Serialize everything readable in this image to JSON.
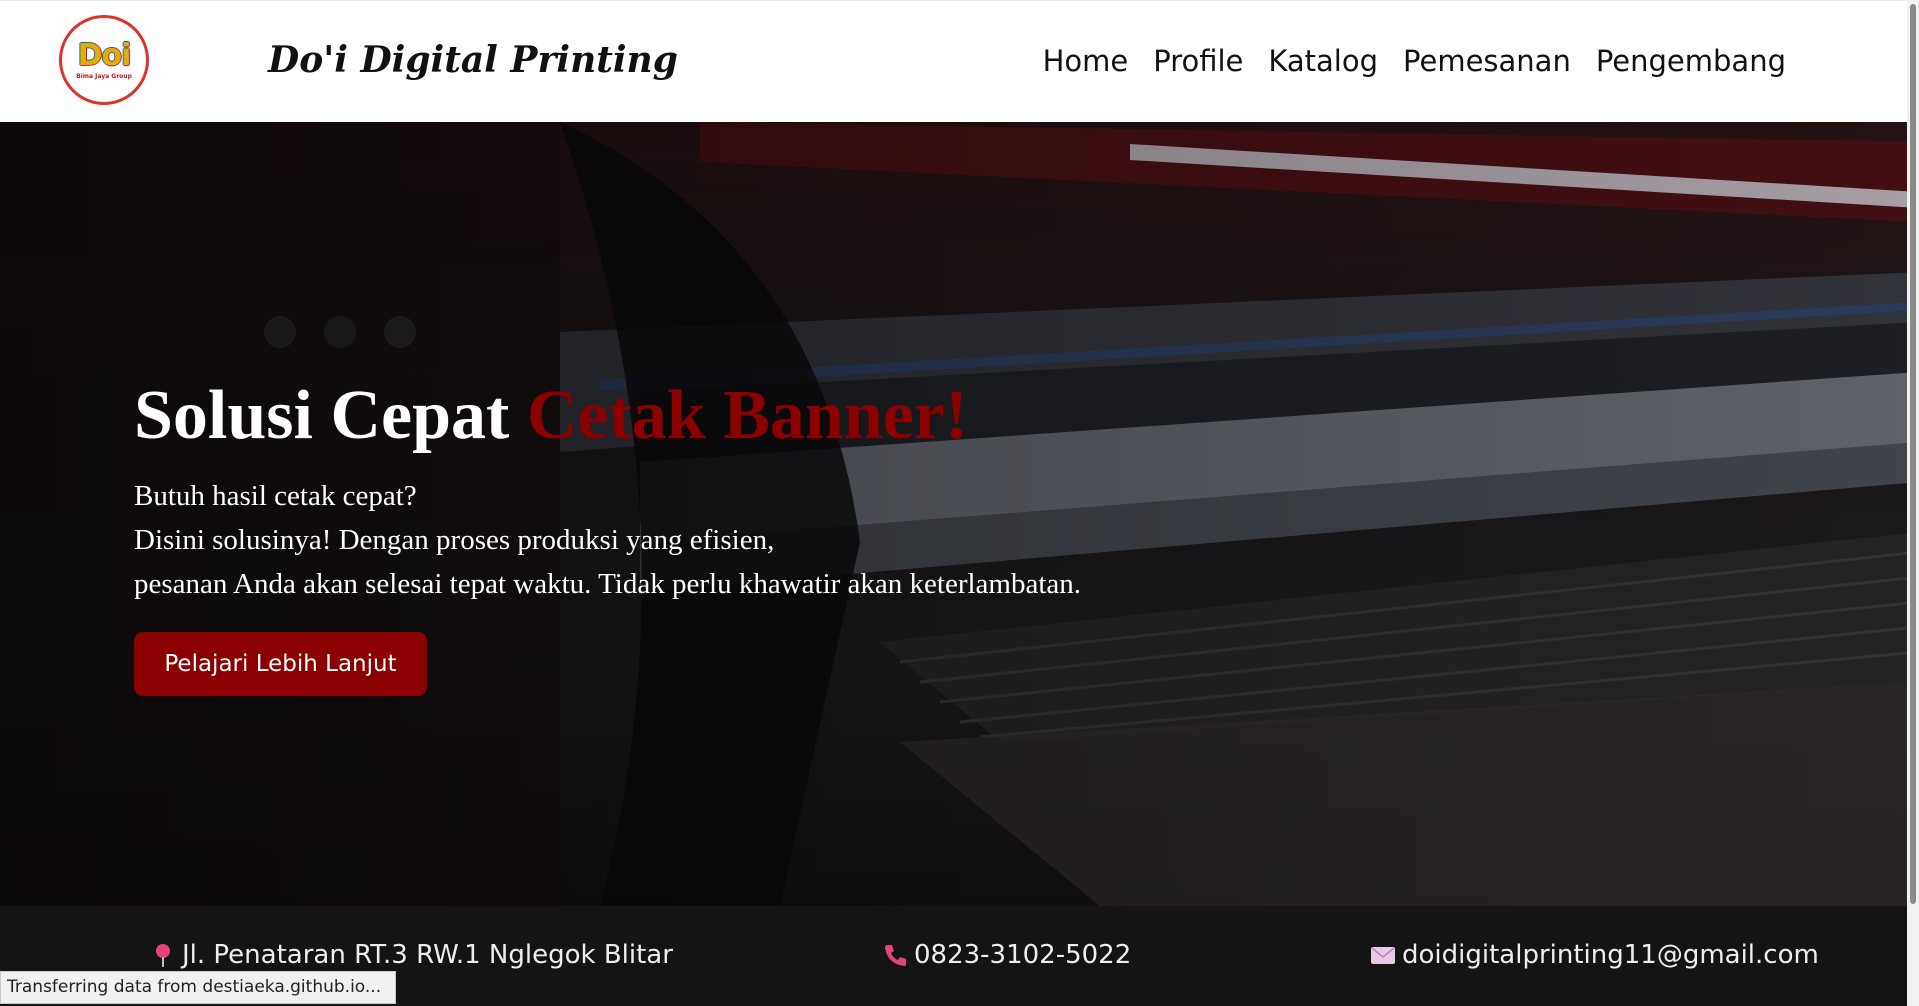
{
  "header": {
    "logo_text": "Doi",
    "logo_subtext": "Bima Jaya Group",
    "brand": "Do'i Digital Printing"
  },
  "nav": {
    "items": [
      {
        "label": "Home"
      },
      {
        "label": "Profile"
      },
      {
        "label": "Katalog"
      },
      {
        "label": "Pemesanan"
      },
      {
        "label": "Pengembang"
      }
    ]
  },
  "hero": {
    "title_main": "Solusi Cepat ",
    "title_accent": "Cetak Banner!",
    "lines": [
      "Butuh hasil cetak cepat?",
      "Disini solusinya! Dengan proses produksi yang efisien,",
      "pesanan Anda akan selesai tepat waktu. Tidak perlu khawatir akan keterlambatan."
    ],
    "cta_label": "Pelajari Lebih Lanjut"
  },
  "footer": {
    "address": "Jl. Penataran RT.3 RW.1 Nglegok Blitar",
    "phone": "0823-3102-5022",
    "email": "doidigitalprinting11@gmail.com"
  },
  "status_bar": "Transferring data from destiaeka.github.io...",
  "colors": {
    "accent": "#8b0000",
    "footer_bg": "#141414",
    "nav_bg": "#ffffff"
  }
}
